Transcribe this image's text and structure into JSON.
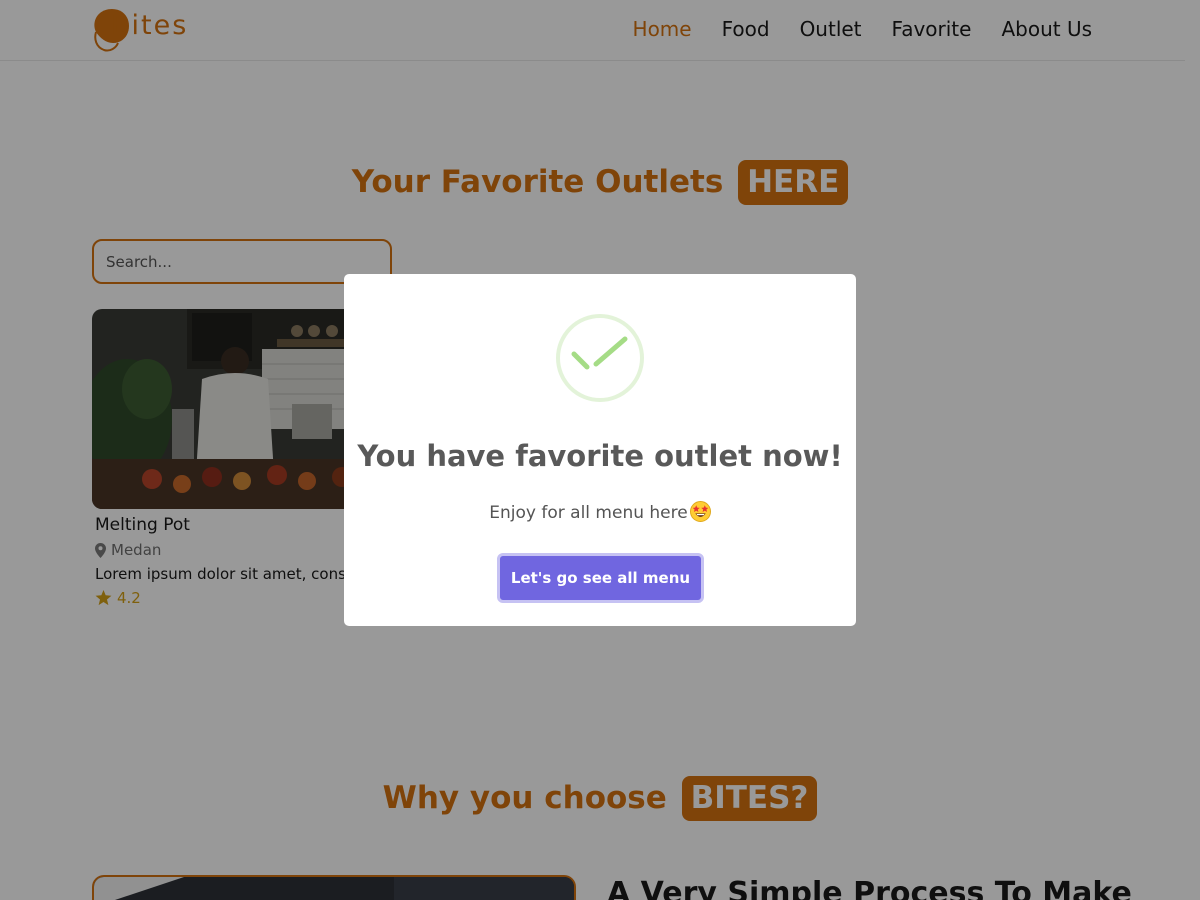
{
  "brand": {
    "name": "Bites",
    "color": "#d4720f"
  },
  "nav": {
    "items": [
      {
        "label": "Home",
        "active": true
      },
      {
        "label": "Food",
        "active": false
      },
      {
        "label": "Outlet",
        "active": false
      },
      {
        "label": "Favorite",
        "active": false
      },
      {
        "label": "About Us",
        "active": false
      }
    ]
  },
  "favorites": {
    "title": "Your Favorite Outlets",
    "title_highlight": "HERE",
    "search_placeholder": "Search..."
  },
  "outlets": [
    {
      "name": "Melting Pot",
      "city": "Medan",
      "description": "Lorem ipsum dolor sit amet, consectetur",
      "rating": "4.2",
      "city_icon": "map-marker-icon",
      "rating_icon": "star-icon"
    }
  ],
  "why": {
    "title": "Why you choose",
    "title_highlight": "BITES?",
    "heading": "A Very Simple Process To Make"
  },
  "modal": {
    "title": "You have favorite outlet now!",
    "text": "Enjoy for all menu here",
    "emoji": "star-struck-emoji",
    "confirm_label": "Let's go see all menu",
    "confirm_color": "#7066e0",
    "icon": "success-check-icon",
    "icon_color": "#a5dc86"
  }
}
